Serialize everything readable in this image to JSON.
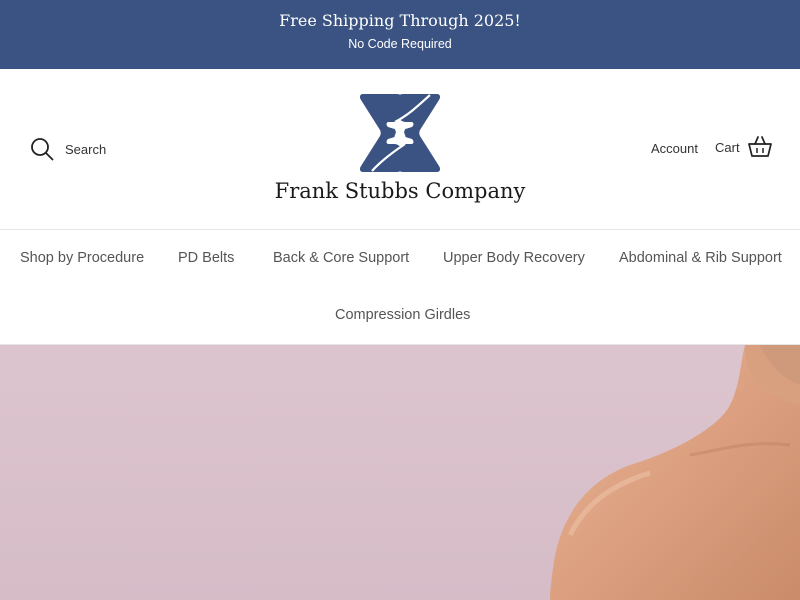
{
  "announcement": {
    "title": "Free Shipping Through 2025!",
    "subtitle": "No Code Required"
  },
  "header": {
    "search_label": "Search",
    "brand_name": "Frank Stubbs Company",
    "account_label": "Account",
    "cart_label": "Cart"
  },
  "nav": {
    "items": [
      "Shop by Procedure",
      "PD Belts",
      "Back & Core Support",
      "Upper Body Recovery",
      "Abdominal & Rib Support",
      "Compression Girdles"
    ]
  },
  "colors": {
    "brand_blue": "#3a5382",
    "hero_background": "#ddc5cf",
    "skin": "#e3ab8b"
  },
  "icons": [
    "search-icon",
    "cart-icon",
    "logo-mark"
  ]
}
